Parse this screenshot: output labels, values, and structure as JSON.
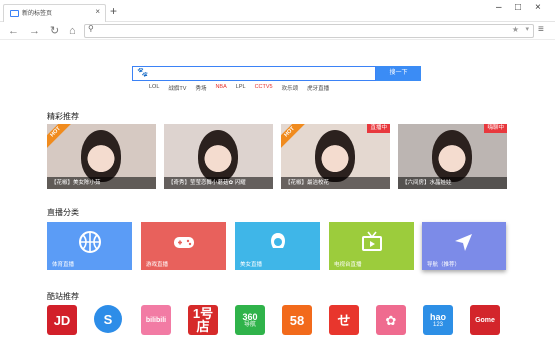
{
  "browser": {
    "tab_title": "新的标签页",
    "tab_close": "×",
    "new_tab": "+",
    "win_minimize": "–",
    "win_maximize": "□",
    "win_close": "×",
    "nav_back": "←",
    "nav_forward": "→",
    "nav_refresh": "↻",
    "nav_home": "⌂",
    "address_value": "",
    "menu_icon": "≡"
  },
  "search": {
    "placeholder": "",
    "button_label": "搜一下",
    "quick_links": [
      {
        "label": "LOL",
        "highlight": false
      },
      {
        "label": "战旗TV",
        "highlight": false
      },
      {
        "label": "秀场",
        "highlight": false
      },
      {
        "label": "NBA",
        "highlight": true
      },
      {
        "label": "LPL",
        "highlight": false
      },
      {
        "label": "CCTV5",
        "highlight": true
      },
      {
        "label": "欢乐颂",
        "highlight": false
      },
      {
        "label": "虎牙直播",
        "highlight": false
      }
    ]
  },
  "sections": {
    "recommend": "精彩推荐",
    "categories": "直播分类",
    "sites": "酷站推荐"
  },
  "cards": [
    {
      "caption": "【花椒】美女陈小茹",
      "badge": "HOT",
      "badge_type": "hot",
      "bg": "#d6c9c2"
    },
    {
      "caption": "【奇秀】莹莹恋舞小蘑菇✿ 闪耀",
      "badge": "",
      "badge_type": "",
      "bg": "#ddd3cf"
    },
    {
      "caption": "【花椒】最洁校花",
      "badge": "直播中",
      "badge_type": "live",
      "hot": "HOT",
      "bg": "#e4d8d0"
    },
    {
      "caption": "【六间房】水晶娃娃",
      "badge": "嗨聊中",
      "badge_type": "live",
      "bg": "#bcb5b2"
    }
  ],
  "categories": [
    {
      "label": "体育直播",
      "color": "#5b9cf6",
      "icon": "basketball-icon"
    },
    {
      "label": "游戏直播",
      "color": "#e8615c",
      "icon": "gamepad-icon"
    },
    {
      "label": "美女直播",
      "color": "#3fb6e8",
      "icon": "girl-icon"
    },
    {
      "label": "电视台直播",
      "color": "#9ccc3c",
      "icon": "tv-icon"
    },
    {
      "label": "导航（推荐）",
      "color": "#7c8be8",
      "icon": "navigation-arrow-icon"
    }
  ],
  "sites": [
    {
      "label": "JD",
      "color": "#d2202a",
      "icon": "jd-logo-icon"
    },
    {
      "label": "S",
      "color": "#2d8de8",
      "icon": "sogou-logo-icon"
    },
    {
      "label": "bilibili",
      "color": "#f27ba4",
      "icon": "bilibili-logo-icon"
    },
    {
      "label": "1号店",
      "color": "#d62a2a",
      "icon": "yhd-logo-icon"
    },
    {
      "label": "360",
      "sub": "导航",
      "color": "#2fb34a",
      "icon": "360-logo-icon"
    },
    {
      "label": "58",
      "color": "#f26a1b",
      "icon": "58-logo-icon"
    },
    {
      "label": "せ",
      "color": "#e8362d",
      "icon": "meituan-logo-icon"
    },
    {
      "label": "✿",
      "color": "#ef6b8f",
      "icon": "flower-logo-icon"
    },
    {
      "label": "hao",
      "sub": "123",
      "color": "#2d8fe6",
      "icon": "hao123-logo-icon"
    },
    {
      "label": "Gome",
      "color": "#d3252b",
      "icon": "gome-logo-icon"
    }
  ]
}
